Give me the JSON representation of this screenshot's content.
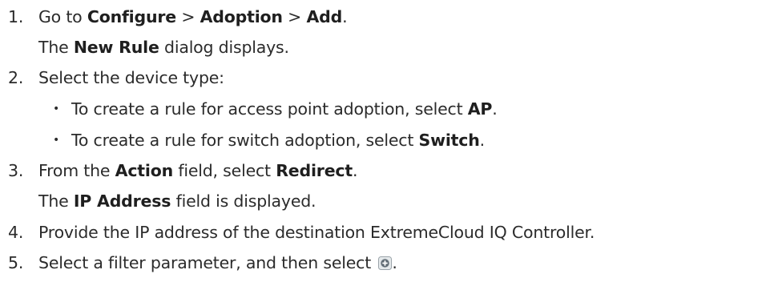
{
  "steps": [
    {
      "number": "1.",
      "parts": [
        "Go to ",
        "Configure",
        " > ",
        "Adoption",
        " > ",
        "Add",
        "."
      ],
      "result_parts": [
        "The ",
        "New Rule",
        " dialog displays."
      ]
    },
    {
      "number": "2.",
      "text": "Select the device type:",
      "bullets": [
        {
          "parts": [
            "To create a rule for access point adoption, select ",
            "AP",
            "."
          ]
        },
        {
          "parts": [
            "To create a rule for switch adoption, select ",
            "Switch",
            "."
          ]
        }
      ]
    },
    {
      "number": "3.",
      "parts": [
        "From the ",
        "Action",
        " field, select ",
        "Redirect",
        "."
      ],
      "result_parts": [
        "The ",
        "IP Address",
        " field is displayed."
      ]
    },
    {
      "number": "4.",
      "text": "Provide the IP address of the destination ExtremeCloud IQ Controller."
    },
    {
      "number": "5.",
      "parts": [
        "Select a filter parameter, and then select ",
        "."
      ],
      "icon": "add-circle-icon"
    }
  ],
  "bullet_glyph": "•",
  "colors": {
    "text": "#2b2b2b",
    "icon_fill": "#5f6a73",
    "icon_ring": "#e6eaec"
  }
}
